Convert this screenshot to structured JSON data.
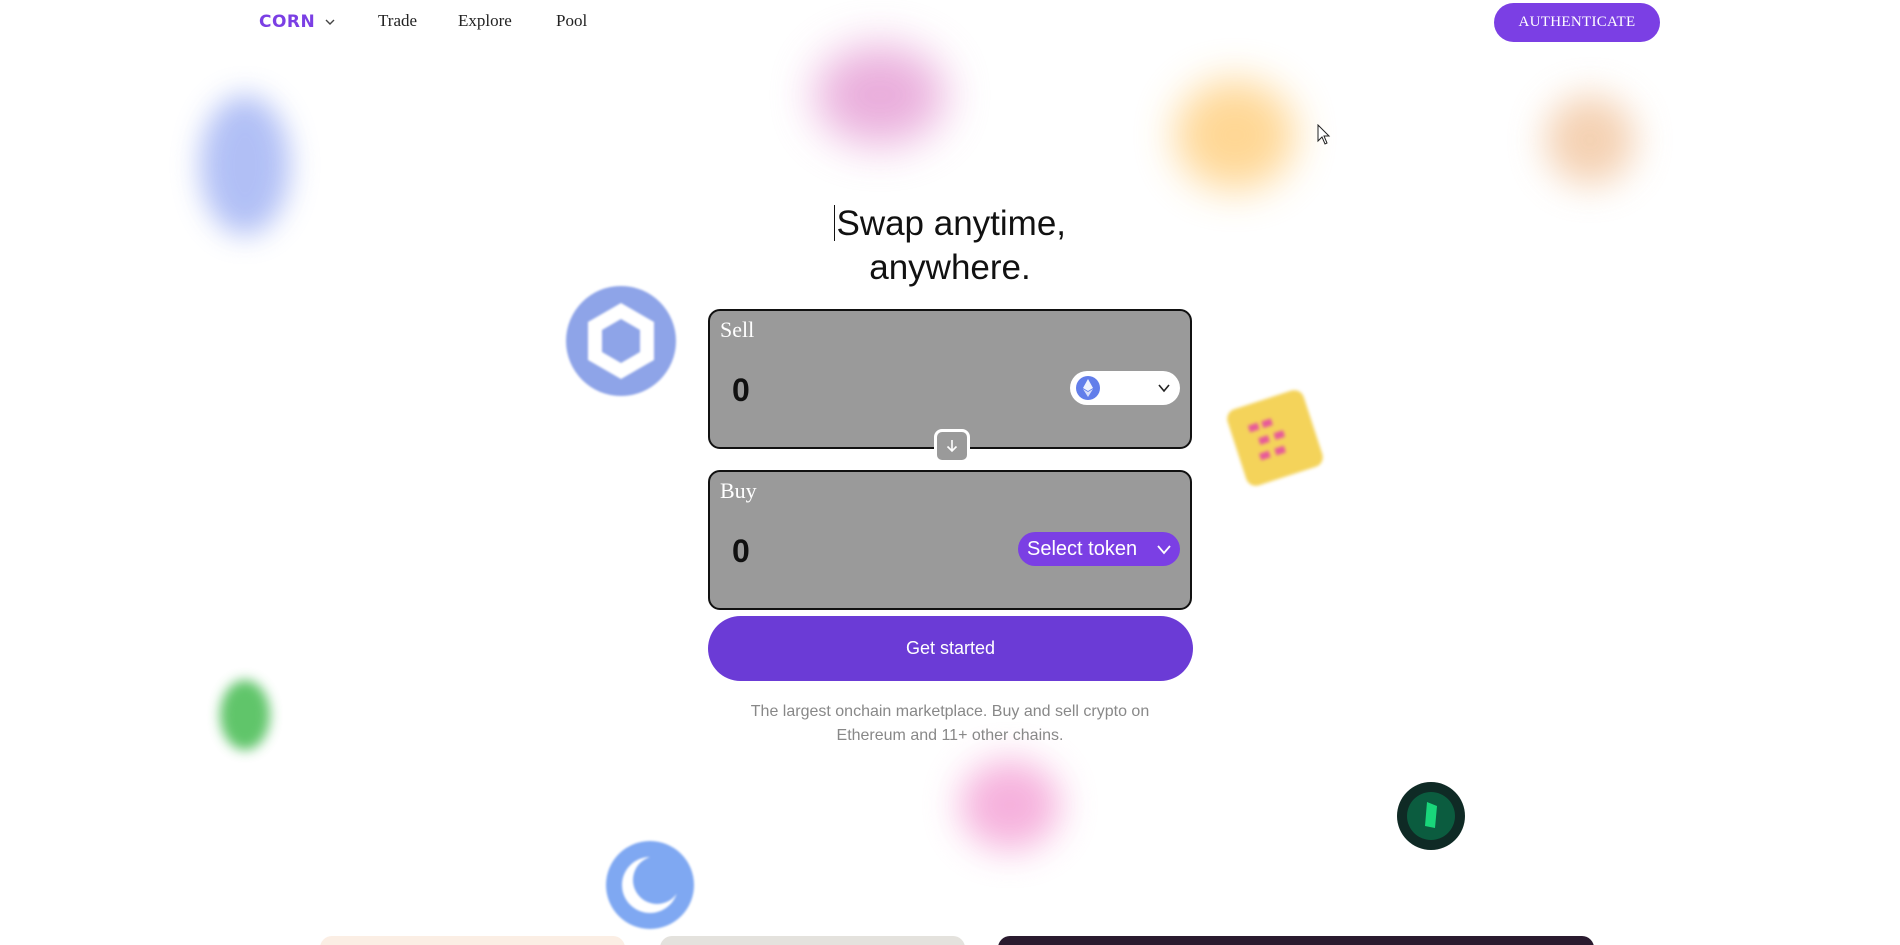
{
  "nav": {
    "brand": "CORN",
    "links": [
      "Trade",
      "Explore",
      "Pool"
    ],
    "auth_label": "AUTHENTICATE"
  },
  "hero": {
    "headline_line1": "Swap anytime,",
    "headline_line2": "anywhere."
  },
  "swap": {
    "sell": {
      "label": "Sell",
      "amount": "0",
      "token_icon": "ethereum-icon"
    },
    "buy": {
      "label": "Buy",
      "amount": "0",
      "select_label": "Select token"
    },
    "switch_icon": "arrow-down-icon",
    "cta_label": "Get started",
    "subtitle": "The largest onchain marketplace. Buy and sell crypto on Ethereum and 11+ other chains."
  },
  "colors": {
    "accent": "#7b3fe4",
    "cta": "#6b3bd6",
    "card_bg": "#9a9a9a",
    "muted_text": "#888888"
  }
}
